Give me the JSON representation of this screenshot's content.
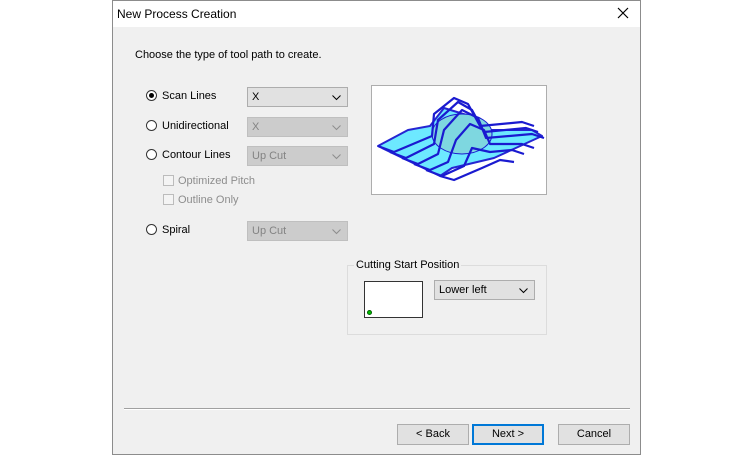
{
  "window": {
    "title": "New Process Creation"
  },
  "instruction": "Choose the type of tool path to create.",
  "options": {
    "scan_lines": {
      "label": "Scan Lines",
      "selected": true,
      "combo_value": "X"
    },
    "unidirectional": {
      "label": "Unidirectional",
      "selected": false,
      "combo_value": "X"
    },
    "contour_lines": {
      "label": "Contour Lines",
      "selected": false,
      "combo_value": "Up Cut"
    },
    "optimized_pitch": {
      "label": "Optimized Pitch",
      "checked": false
    },
    "outline_only": {
      "label": "Outline Only",
      "checked": false
    },
    "spiral": {
      "label": "Spiral",
      "selected": false,
      "combo_value": "Up Cut"
    }
  },
  "cutting_start": {
    "group_label": "Cutting Start Position",
    "value": "Lower left"
  },
  "buttons": {
    "back": "< Back",
    "next": "Next >",
    "cancel": "Cancel"
  },
  "colors": {
    "preview_fill": "#66e8ff",
    "preview_stroke": "#1a1ad0",
    "dome_fill": "#7ed7e0",
    "start_dot": "#00c000"
  }
}
